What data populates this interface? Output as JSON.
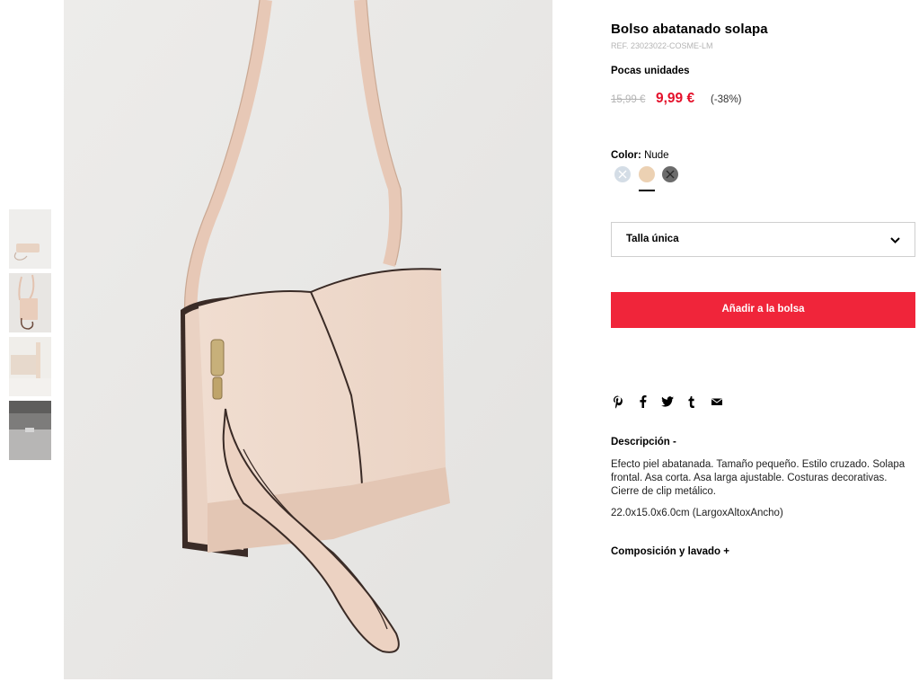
{
  "product": {
    "title": "Bolso abatanado solapa",
    "ref": "REF. 23023022-COSME-LM",
    "stock": "Pocas unidades",
    "old_price": "15,99 €",
    "new_price": "9,99 €",
    "discount": "(-38%)",
    "price_color": "#e4102a"
  },
  "color": {
    "label": "Color:",
    "selected": "Nude",
    "swatches": [
      {
        "name": "light-blue",
        "hex": "#d4dde6",
        "available": false
      },
      {
        "name": "nude",
        "hex": "#ecd1b3",
        "available": true,
        "selected": true
      },
      {
        "name": "grey",
        "hex": "#6b6b6b",
        "available": false
      }
    ]
  },
  "size": {
    "selected": "Talla única"
  },
  "cart": {
    "add_label": "Añadir a la bolsa",
    "button_color": "#f0253a"
  },
  "share": {
    "icons": [
      "pinterest-icon",
      "facebook-icon",
      "twitter-icon",
      "tumblr-icon",
      "email-icon"
    ]
  },
  "description": {
    "title": "Descripción -",
    "text": "Efecto piel abatanada. Tamaño pequeño. Estilo cruzado. Solapa frontal. Asa corta. Asa larga ajustable. Costuras decorativas. Cierre de clip metálico.",
    "dimensions": "22.0x15.0x6.0cm (LargoxAltoxAncho)"
  },
  "composition": {
    "title": "Composición y lavado +"
  }
}
